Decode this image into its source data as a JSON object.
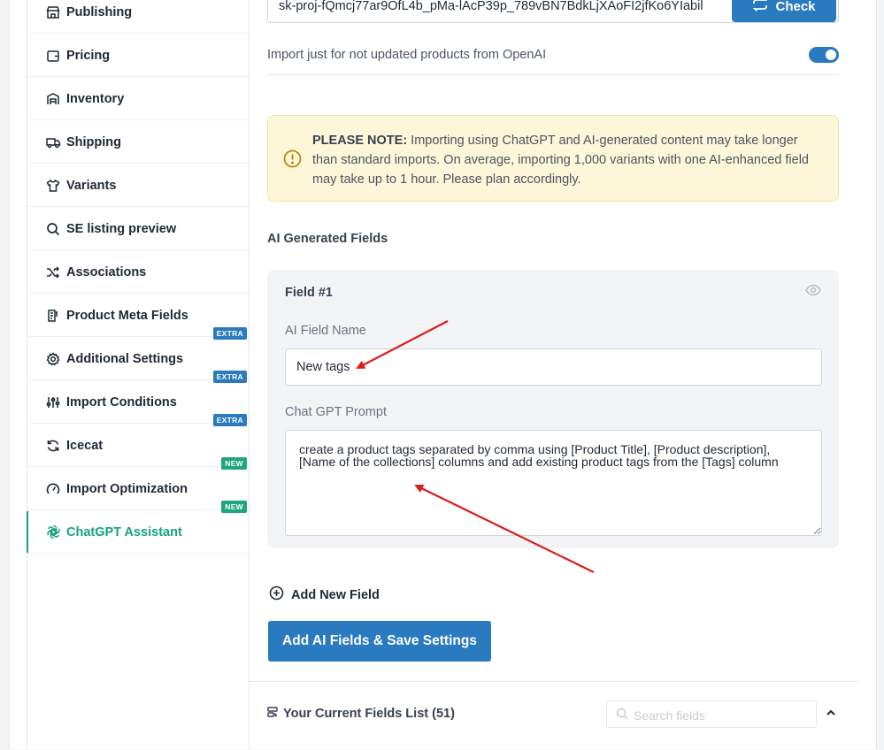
{
  "sidebar": {
    "items": [
      {
        "label": "Publishing",
        "icon": "store-icon"
      },
      {
        "label": "Pricing",
        "icon": "wallet-icon"
      },
      {
        "label": "Inventory",
        "icon": "warehouse-icon"
      },
      {
        "label": "Shipping",
        "icon": "truck-icon"
      },
      {
        "label": "Variants",
        "icon": "shirt-icon"
      },
      {
        "label": "SE listing preview",
        "icon": "search-icon"
      },
      {
        "label": "Associations",
        "icon": "shuffle-icon"
      },
      {
        "label": "Product Meta Fields",
        "icon": "meta-doc-icon"
      },
      {
        "label": "Additional Settings",
        "icon": "gear-icon",
        "badge": "EXTRA"
      },
      {
        "label": "Import Conditions",
        "icon": "sliders-icon",
        "badge": "EXTRA"
      },
      {
        "label": "Icecat",
        "icon": "refresh-icon",
        "badge": "EXTRA"
      },
      {
        "label": "Import Optimization",
        "icon": "gauge-icon",
        "badge": "NEW"
      },
      {
        "label": "ChatGPT Assistant",
        "icon": "openai-icon",
        "badge": "NEW",
        "active": true
      }
    ]
  },
  "api": {
    "key_value": "sk-proj-fQmcj77ar9OfL4b_pMa-lAcP39p_789vBN7BdkLjXAoFI2jfKo6YIabil",
    "check_label": "Check"
  },
  "toggle": {
    "label": "Import just for not updated products from OpenAI",
    "on": true
  },
  "note": {
    "strong": "PLEASE NOTE:",
    "text": " Importing using ChatGPT and AI-generated content may take longer than standard imports. On average, importing 1,000 variants with one AI-enhanced field may take up to 1 hour. Please plan accordingly."
  },
  "section_title": "AI Generated Fields",
  "field": {
    "heading": "Field #1",
    "name_label": "AI Field Name",
    "name_value": "New tags",
    "prompt_label": "Chat GPT Prompt",
    "prompt_value": "create a product tags separated by comma using [Product Title], [Product description], [Name of the collections] columns and add existing product tags from the [Tags] column"
  },
  "add_field_label": "Add New Field",
  "save_label": "Add AI Fields & Save Settings",
  "fields_list": {
    "title": "Your Current Fields List (51)",
    "search_placeholder": "Search fields"
  },
  "colors": {
    "accent": "#2a7ac0",
    "active": "#16a37f",
    "note_bg": "#fdf6d8",
    "annotation": "#e01b1b"
  }
}
